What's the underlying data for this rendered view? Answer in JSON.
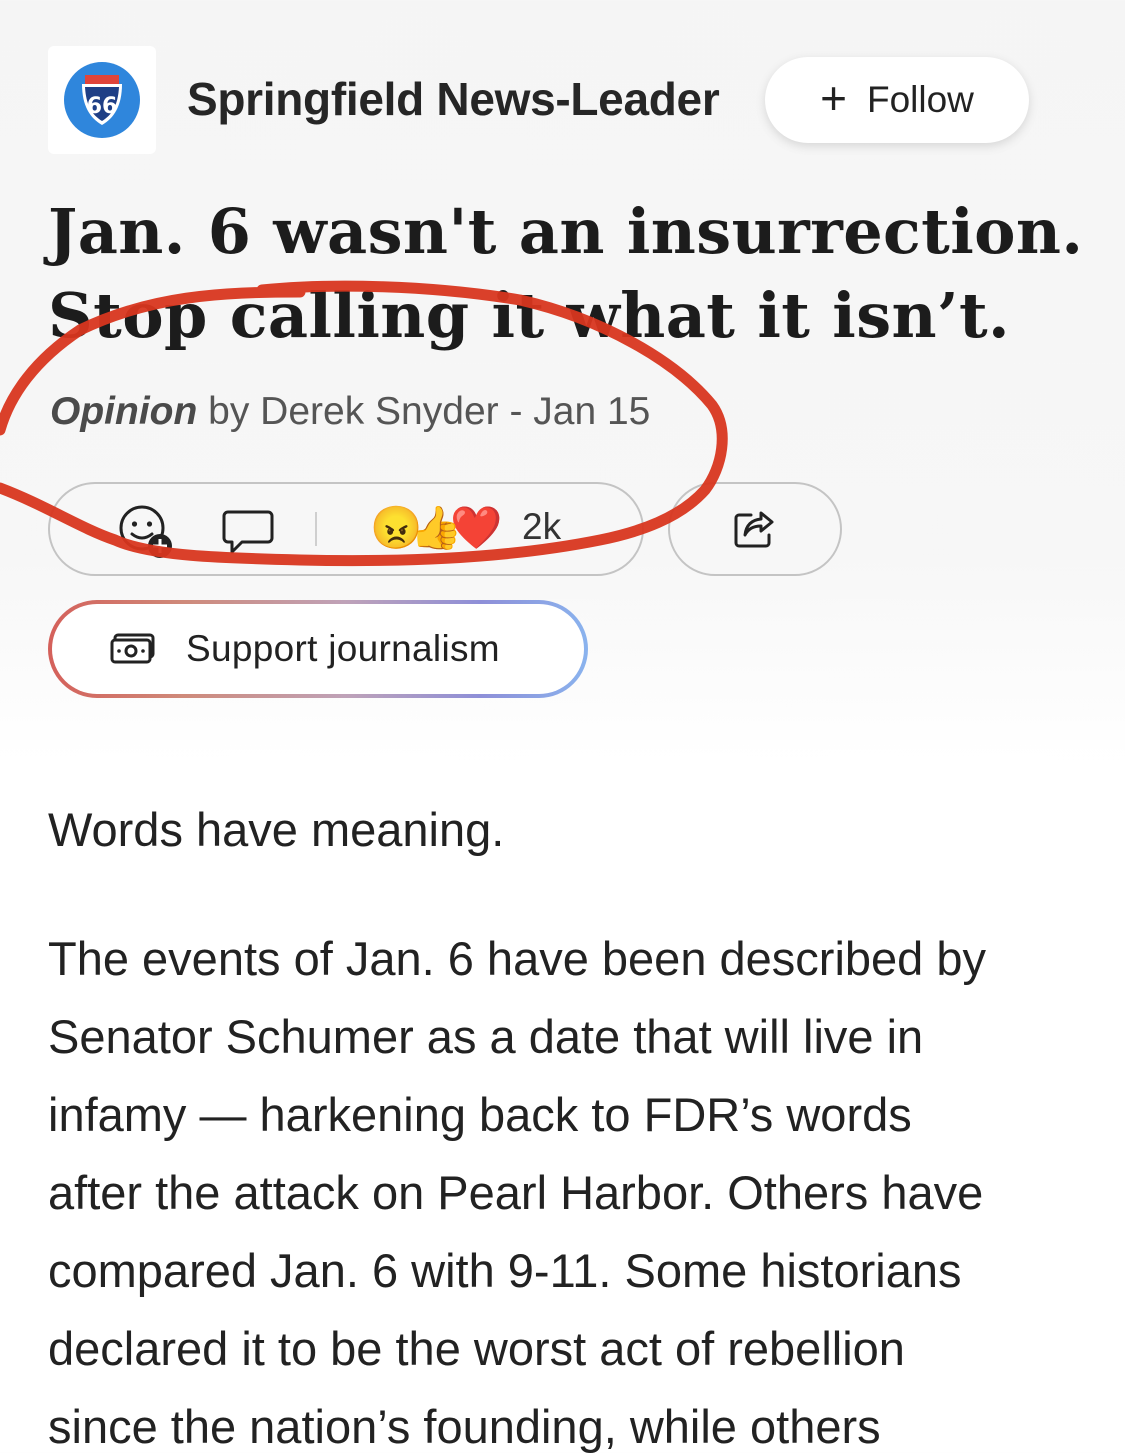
{
  "publisher": {
    "logo_text": "66",
    "name": "Springfield News-Leader",
    "follow_label": "Follow"
  },
  "headline": {
    "line1": "Jan. 6 wasn't an insurrection.",
    "line2": "Stop calling it what it isn’t."
  },
  "byline": {
    "section": "Opinion",
    "rest": "by Derek Snyder - Jan 15"
  },
  "reactions": {
    "emojis": [
      "😠",
      "👍",
      "❤️"
    ],
    "count": "2k"
  },
  "support": {
    "label": "Support journalism"
  },
  "article": {
    "lead": "Words have meaning.",
    "paragraph_lines": [
      "The events of Jan. 6 have been described by",
      "Senator Schumer as a date that will live in",
      "infamy — harkening back to FDR’s words",
      "after the attack on Pearl Harbor. Others have",
      "compared Jan. 6 with 9-11. Some historians",
      "declared it to be the worst act of rebellion",
      "since the nation’s founding, while others"
    ]
  },
  "colors": {
    "annotation_red": "#d8361f",
    "logo_blue": "#2f86dc",
    "logo_red": "#e0443a"
  },
  "icons": {
    "react": "add-reaction-icon",
    "comment": "comment-icon",
    "share": "share-icon",
    "support": "money-icon",
    "follow": "plus-icon"
  }
}
